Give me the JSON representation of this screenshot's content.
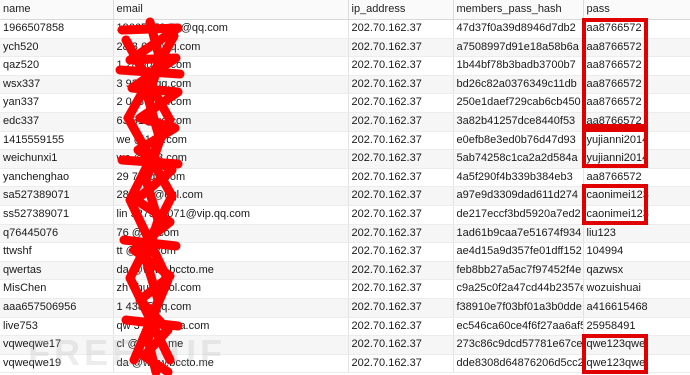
{
  "columns": [
    "name",
    "email",
    "ip_address",
    "members_pass_hash",
    "pass"
  ],
  "rows": [
    {
      "name": "1966507858",
      "email": "19665078 58@qq.com",
      "ip": "202.70.162.37",
      "hash": "47d37f0a39d8946d7db2",
      "pass": "aa8766572"
    },
    {
      "name": "ych520",
      "email": "28 3 63@qq.com",
      "ip": "202.70.162.37",
      "hash": "a7508997d91e18a58b6a",
      "pass": "aa8766572"
    },
    {
      "name": "qaz520",
      "email": "1 285@qq.com",
      "ip": "202.70.162.37",
      "hash": "1b44bf78b3badb3700b7",
      "pass": "aa8766572"
    },
    {
      "name": "wsx337",
      "email": "3 932@qq.com",
      "ip": "202.70.162.37",
      "hash": "bd26c82a0376349c11db",
      "pass": "aa8766572"
    },
    {
      "name": "yan337",
      "email": "2 048@qq.com",
      "ip": "202.70.162.37",
      "hash": "250e1daef729cab6cb450",
      "pass": "aa8766572"
    },
    {
      "name": "edc337",
      "email": "63 31@qq.com",
      "ip": "202.70.162.37",
      "hash": "3a82b41257dce8440f53",
      "pass": "aa8766572"
    },
    {
      "name": "1415559155",
      "email": "we @163.com",
      "ip": "202.70.162.37",
      "hash": "e0efb8e3ed0b76d47d93",
      "pass": "yujianni2014"
    },
    {
      "name": "weichunxi1",
      "email": "we @163.com",
      "ip": "202.70.162.37",
      "hash": "5ab74258c1ca2a2d584a",
      "pass": "yujianni2014"
    },
    {
      "name": "yanchenghao",
      "email": "29 7@qq.com",
      "ip": "202.70.162.37",
      "hash": "4a5f290f4b339b384eb3",
      "pass": "aa8766572"
    },
    {
      "name": "sa527389071",
      "email": "28 4 03@qql.com",
      "ip": "202.70.162.37",
      "hash": "a97e9d3309dad611d274",
      "pass": "caonimei123"
    },
    {
      "name": "ss527389071",
      "email": "lin 527389071@vip.qq.com",
      "ip": "202.70.162.37",
      "hash": "de217eccf3bd5920a7ed2",
      "pass": "caonimei123"
    },
    {
      "name": "q76445076",
      "email": "76 @qq.com",
      "ip": "202.70.162.37",
      "hash": "1ad61b9caa7e51674f934",
      "pass": "liu123"
    },
    {
      "name": "ttwshf",
      "email": "tt @1 3.com",
      "ip": "202.70.162.37",
      "hash": "ae4d15a9d357fe01dff152",
      "pass": "104994"
    },
    {
      "name": "qwertas",
      "email": "da @www.bccto.me",
      "ip": "202.70.162.37",
      "hash": "feb8bb27a5ac7f97452f4e",
      "pass": "qazwsx"
    },
    {
      "name": "MisChen",
      "email": "zh shui@aol.com",
      "ip": "202.70.162.37",
      "hash": "c9a25c0f2a47cd44b2357e",
      "pass": "wozuishuai"
    },
    {
      "name": "aaa657506956",
      "email": "1 438@qq.com",
      "ip": "202.70.162.37",
      "hash": "f38910e7f03bf01a3b0dde",
      "pass": "a416615468"
    },
    {
      "name": "live753",
      "email": "qw 3 11@sina.com",
      "ip": "202.70.162.37",
      "hash": "ec546ca60ce4f6f27aa6af5",
      "pass": "25958491"
    },
    {
      "name": "vqweqwe17",
      "email": "cl @bccto.me",
      "ip": "202.70.162.37",
      "hash": "273c86c9dcd57781e67ce",
      "pass": "qwe123qwe"
    },
    {
      "name": "vqweqwe19",
      "email": "da @www.bccto.me",
      "ip": "202.70.162.37",
      "hash": "dde8308d64876206d5cc2",
      "pass": "qwe123qwe"
    }
  ],
  "watermark": "FREEBUF",
  "colors": {
    "scribble": "#ff0000",
    "box": "#e00000"
  }
}
